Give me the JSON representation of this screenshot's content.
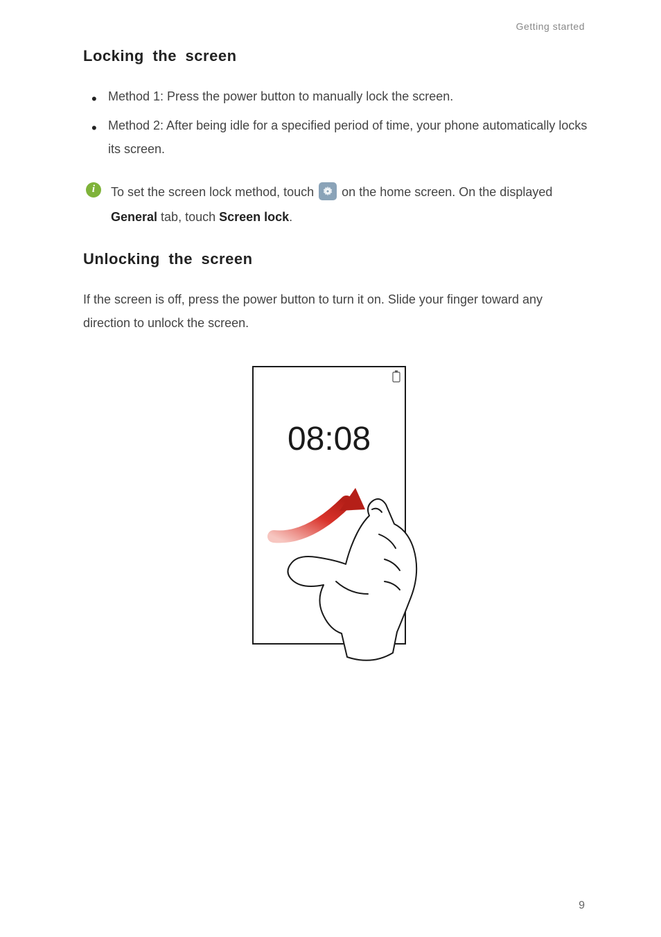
{
  "chapter": "Getting started",
  "section1": {
    "title": "Locking  the  screen",
    "bullets": [
      "Method 1: Press the power button to manually lock the screen.",
      "Method 2: After being idle for a specified period of time, your phone automatically locks its screen."
    ],
    "info_pre": "To set the screen lock method, touch ",
    "info_mid": " on the home screen. On the displayed ",
    "info_b1": "General",
    "info_mid2": " tab, touch ",
    "info_b2": "Screen lock",
    "info_end": "."
  },
  "section2": {
    "title": "Unlocking  the  screen",
    "para": "If the screen is off, press the power button to turn it on. Slide your finger toward any direction to unlock the screen."
  },
  "figure": {
    "clock": "08:08"
  },
  "pageNumber": "9"
}
